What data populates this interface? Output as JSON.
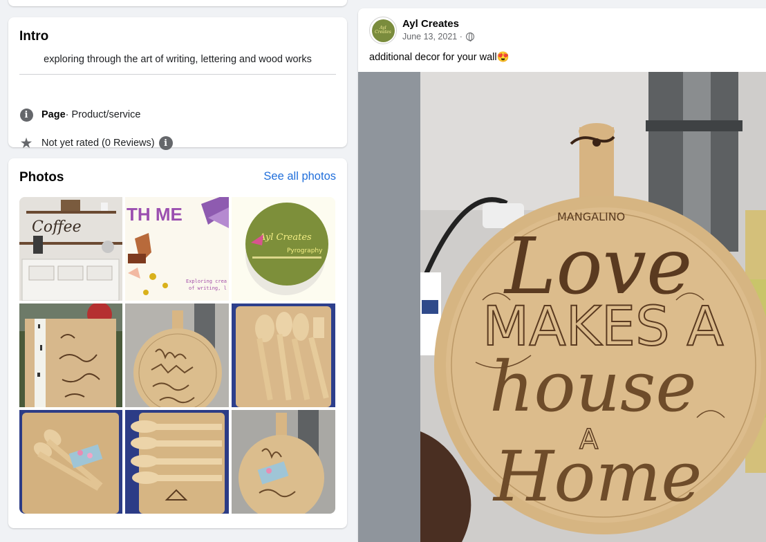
{
  "intro": {
    "title": "Intro",
    "bio": "exploring through the art of writing, lettering and wood works",
    "page_label": "Page",
    "page_category": " · Product/service",
    "rating_text": "Not yet rated (0 Reviews)",
    "icons": [
      "info-icon",
      "star-icon",
      "info-icon"
    ]
  },
  "photos": {
    "title": "Photos",
    "see_all": "See all photos",
    "tiles": [
      {
        "name": "coffee-shelf-photo",
        "text": "Coffee"
      },
      {
        "name": "cover-banner-photo",
        "text": "TH ME",
        "text2": "Exploring crea",
        "text3": "of writing, l"
      },
      {
        "name": "ayl-creates-logo-photo",
        "text": "Ayl Creates",
        "text2": "Pyrography"
      },
      {
        "name": "birch-board-photo"
      },
      {
        "name": "love-house-board-thumb"
      },
      {
        "name": "spoons-board-photo"
      },
      {
        "name": "utensils-tied-photo"
      },
      {
        "name": "anitas-kitchen-spoons-photo"
      },
      {
        "name": "love-board-gift-photo"
      }
    ]
  },
  "post": {
    "author": "Ayl Creates",
    "date": "June 13, 2021 ·",
    "caption": "additional decor for your wall😍",
    "avatar_text": "Ayl Creates",
    "photo_texts": {
      "brand": "MANGALINO",
      "line1": "Love",
      "line2": "MAKES A",
      "line3": "house",
      "line4": "A",
      "line5": "Home"
    }
  },
  "colors": {
    "link": "#216fdb",
    "background": "#f0f2f5",
    "wood": "#d9b98a"
  }
}
